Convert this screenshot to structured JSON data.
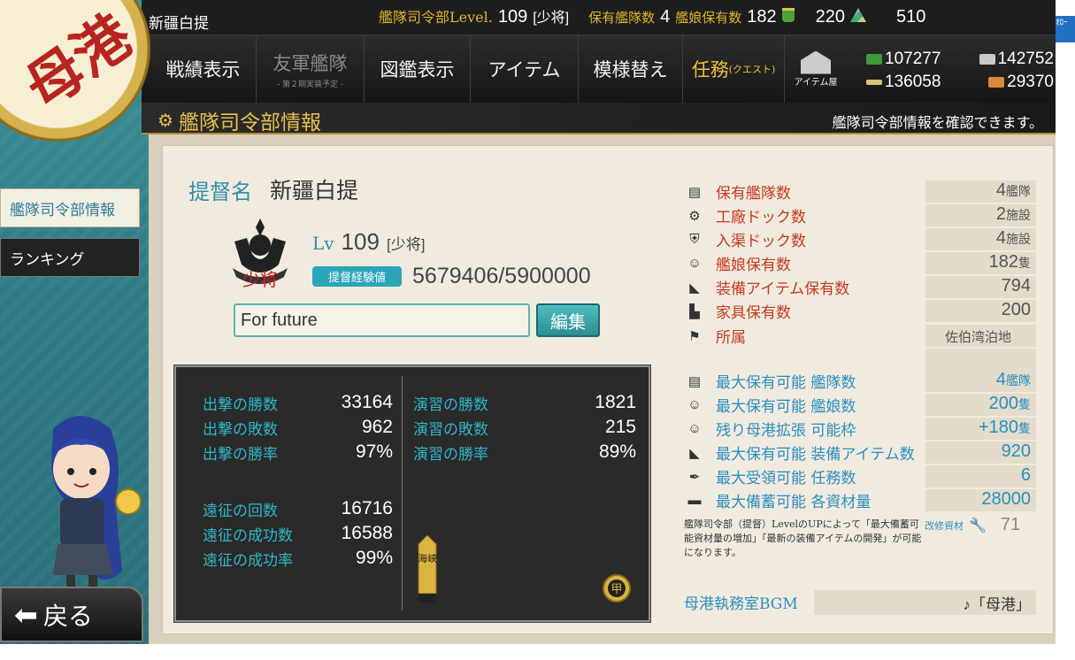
{
  "topbar": {
    "admiral_name": "新疆白提",
    "hq_label": "艦隊司令部",
    "level_label": "Level.",
    "level": "109",
    "rank": "[少将]",
    "fleets_label": "保有艦隊数",
    "fleets": "4",
    "ships_label": "艦娘保有数",
    "ships": "182",
    "buckets": "220",
    "dev_mats": "510",
    "edge_tag": "ｵﾛｰ"
  },
  "nav": {
    "items": [
      {
        "label": "戦績表示"
      },
      {
        "label": "友軍艦隊",
        "sub": "- 第２期実装予定 -"
      },
      {
        "label": "図鑑表示"
      },
      {
        "label": "アイテム"
      },
      {
        "label": "模様替え"
      },
      {
        "label": "任務",
        "small": "(クエスト)"
      }
    ],
    "shop_label": "アイテム屋"
  },
  "resources": {
    "fuel": "107277",
    "ammo": "142752",
    "steel": "136058",
    "bauxite": "29370"
  },
  "header": {
    "title": "艦隊司令部情報",
    "description": "艦隊司令部情報を確認できます。"
  },
  "logo": {
    "kanji": "母港"
  },
  "sidebar": {
    "items": [
      {
        "label": "艦隊司令部情報"
      },
      {
        "label": "ランキング"
      }
    ],
    "back_label": "戻る"
  },
  "profile": {
    "name_label": "提督名",
    "name": "新疆白提",
    "lv_label": "Lv",
    "level": "109",
    "rank": "[少将]",
    "rank_emblem": "少将",
    "exp_label": "提督経験値",
    "exp": "5679406/5900000",
    "comment": "For future",
    "edit_label": "編集"
  },
  "stats": {
    "sortie": [
      {
        "label": "出撃の勝数",
        "value": "33164"
      },
      {
        "label": "出撃の敗数",
        "value": "962"
      },
      {
        "label": "出撃の勝率",
        "value": "97%"
      }
    ],
    "exercise": [
      {
        "label": "演習の勝数",
        "value": "1821"
      },
      {
        "label": "演習の敗数",
        "value": "215"
      },
      {
        "label": "演習の勝率",
        "value": "89%"
      }
    ],
    "expedition": [
      {
        "label": "遠征の回数",
        "value": "16716"
      },
      {
        "label": "遠征の成功数",
        "value": "16588"
      },
      {
        "label": "遠征の成功率",
        "value": "99%"
      }
    ],
    "medal_text": "海峡",
    "badge_text": "甲"
  },
  "info": {
    "rows": [
      {
        "label": "保有艦隊数",
        "value": "4",
        "unit": "艦隊",
        "icon": "fleet-icon"
      },
      {
        "label": "工廠ドック数",
        "value": "2",
        "unit": "施設",
        "icon": "gear-icon"
      },
      {
        "label": "入渠ドック数",
        "value": "4",
        "unit": "施設",
        "icon": "repair-icon"
      },
      {
        "label": "艦娘保有数",
        "value": "182",
        "unit": "隻",
        "icon": "girl-icon"
      },
      {
        "label": "装備アイテム保有数",
        "value": "794",
        "unit": "",
        "icon": "equipment-icon"
      },
      {
        "label": "家具保有数",
        "value": "200",
        "unit": "",
        "icon": "furniture-icon"
      },
      {
        "label": "所属",
        "value": "佐伯湾泊地",
        "unit": "",
        "icon": "flag-icon"
      }
    ],
    "max_rows": [
      {
        "label": "最大保有可能 艦隊数",
        "value": "4",
        "unit": "艦隊",
        "icon": "fleet-icon"
      },
      {
        "label": "最大保有可能 艦娘数",
        "value": "200",
        "unit": "隻",
        "icon": "girl-icon"
      },
      {
        "label": "残り母港拡張 可能枠",
        "value": "+180",
        "unit": "隻",
        "icon": "girl-icon"
      },
      {
        "label": "最大保有可能 装備アイテム数",
        "value": "920",
        "unit": "",
        "icon": "equipment-icon"
      },
      {
        "label": "最大受領可能 任務数",
        "value": "6",
        "unit": "",
        "icon": "quill-icon"
      },
      {
        "label": "最大備蓄可能 各資材量",
        "value": "28000",
        "unit": "",
        "icon": "storage-icon"
      }
    ],
    "note": "艦隊司令部（提督）LevelのUPによって「最大備蓄可能資材量の増加」「最新の装備アイテムの開発」が可能になります。",
    "kaishu_label": "改修資材",
    "kaishu_value": "71",
    "bgm_label": "母港執務室BGM",
    "bgm_value": "♪「母港」"
  }
}
